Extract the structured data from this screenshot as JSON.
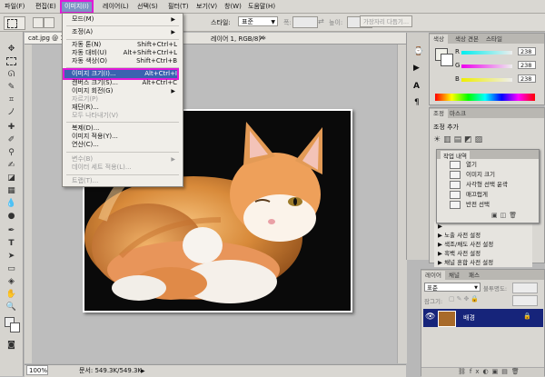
{
  "menubar": {
    "items": [
      "파일(F)",
      "편집(E)",
      "이미지(I)",
      "레이어(L)",
      "선택(S)",
      "필터(T)",
      "보기(V)",
      "창(W)",
      "도움말(H)"
    ],
    "active_index": 2
  },
  "options_bar": {
    "style_label": "스타일:",
    "style_value": "표준",
    "width_label": "폭:",
    "height_label": "높이:",
    "refine_button": "가장자리 다듬기..."
  },
  "document": {
    "tab_title": "cat.jpg @ 10",
    "tab_title_right": "레이어 1, RGB/8) *",
    "zoom": "100%",
    "doc_size": "문서: 549.3K/549.3K"
  },
  "image_menu": {
    "items": [
      {
        "label": "모드(M)",
        "shortcut": "",
        "submenu": true,
        "disabled": false
      },
      {
        "sep": true
      },
      {
        "label": "조정(A)",
        "shortcut": "",
        "submenu": true,
        "disabled": false
      },
      {
        "sep": true
      },
      {
        "label": "자동 톤(N)",
        "shortcut": "Shift+Ctrl+L",
        "disabled": false
      },
      {
        "label": "자동 대비(U)",
        "shortcut": "Alt+Shift+Ctrl+L",
        "disabled": false
      },
      {
        "label": "자동 색상(O)",
        "shortcut": "Shift+Ctrl+B",
        "disabled": false
      },
      {
        "sep": true
      },
      {
        "label": "이미지 크기(I)...",
        "shortcut": "Alt+Ctrl+I",
        "disabled": false,
        "highlighted": true
      },
      {
        "label": "캔버스 크기(S)...",
        "shortcut": "Alt+Ctrl+C",
        "disabled": false
      },
      {
        "label": "이미지 회전(G)",
        "shortcut": "",
        "submenu": true,
        "disabled": false
      },
      {
        "label": "자르기(P)",
        "shortcut": "",
        "disabled": true
      },
      {
        "label": "재단(R)...",
        "shortcut": "",
        "disabled": false
      },
      {
        "label": "모두 나타내기(V)",
        "shortcut": "",
        "disabled": true
      },
      {
        "sep": true
      },
      {
        "label": "복제(D)...",
        "shortcut": "",
        "disabled": false
      },
      {
        "label": "이미지 적용(Y)...",
        "shortcut": "",
        "disabled": false
      },
      {
        "label": "연산(C)...",
        "shortcut": "",
        "disabled": false
      },
      {
        "sep": true
      },
      {
        "label": "변수(B)",
        "shortcut": "",
        "submenu": true,
        "disabled": true
      },
      {
        "label": "데이터 세트 적용(L)...",
        "shortcut": "",
        "disabled": true
      },
      {
        "sep": true
      },
      {
        "label": "트랩(T)...",
        "shortcut": "",
        "disabled": true
      }
    ]
  },
  "color_panel": {
    "tabs": [
      "색상",
      "색상 견본",
      "스타일"
    ],
    "r_label": "R",
    "g_label": "G",
    "b_label": "B",
    "r_value": "238",
    "g_value": "238",
    "b_value": "238"
  },
  "adjust_panel": {
    "tabs": [
      "조정",
      "마스크"
    ],
    "title": "조정 추가"
  },
  "history_panel": {
    "title": "작업 내역",
    "items": [
      "열기",
      "이미지 크기",
      "사각형 선택 윤곽",
      "매끄럽게",
      "반전 선택"
    ]
  },
  "presets": [
    "노출 사전 설정",
    "색조/채도 사전 설정",
    "흑백 사전 설정",
    "채널 혼합 사전 설정"
  ],
  "layers_panel": {
    "tabs": [
      "레이어",
      "채널",
      "패스"
    ],
    "blend_mode": "표준",
    "opacity_label": "불투명도:",
    "lock_label": "잠그기:",
    "layer_name": "배경"
  },
  "colors": {
    "highlight": "#e01ad7",
    "menu_selection": "#3a63b0",
    "layer_selection": "#16247a"
  }
}
